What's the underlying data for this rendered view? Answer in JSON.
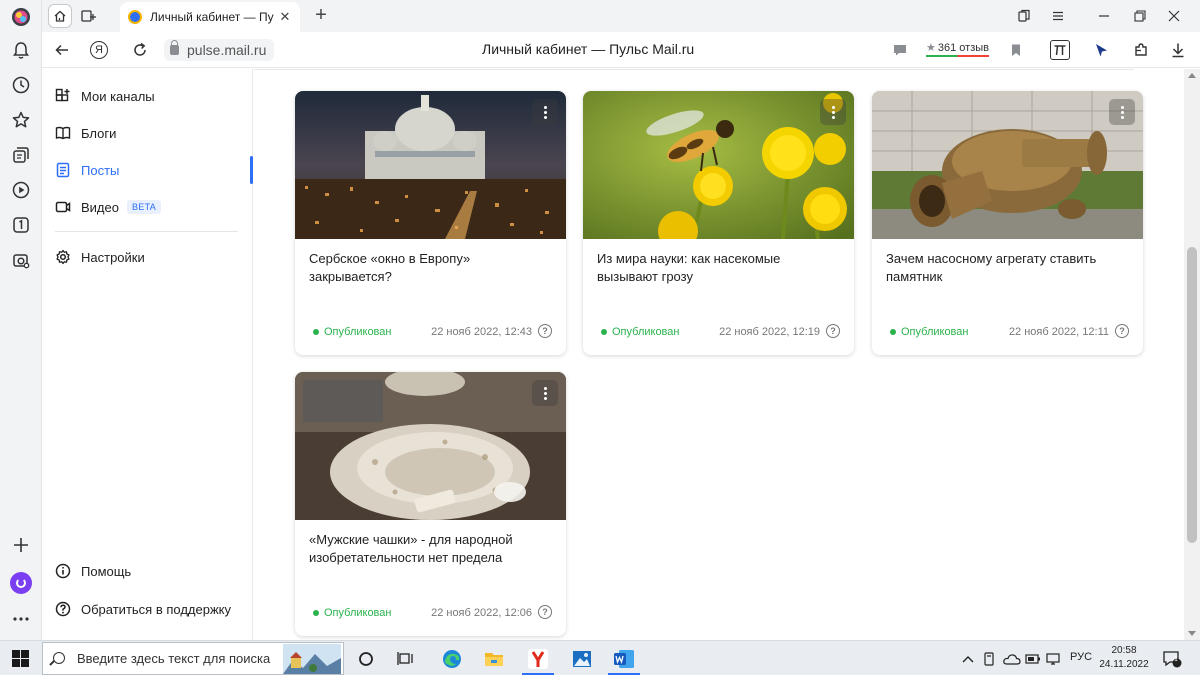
{
  "browser": {
    "tab_title": "Личный кабинет — Пу",
    "url": "pulse.mail.ru",
    "page_title": "Личный кабинет — Пульс Mail.ru",
    "rating_count": "361",
    "rating_label": "отзыв",
    "yandex_letter": "Я"
  },
  "sidebar": {
    "items": [
      {
        "label": "Мои каналы",
        "icon": "channels-icon"
      },
      {
        "label": "Блоги",
        "icon": "book-icon"
      },
      {
        "label": "Посты",
        "icon": "document-icon",
        "active": true
      },
      {
        "label": "Видео",
        "icon": "video-icon",
        "badge": "BETA"
      },
      {
        "label": "Настройки",
        "icon": "gear-icon"
      }
    ],
    "bottom": [
      {
        "label": "Помощь",
        "icon": "info-icon"
      },
      {
        "label": "Обратиться в поддержку",
        "icon": "question-icon"
      }
    ]
  },
  "posts": [
    {
      "title": "Сербское «окно в Европу» закрывается?",
      "status": "Опубликован",
      "date": "22 нояб 2022, 12:43",
      "image": "cathedral-photo"
    },
    {
      "title": "Из мира науки: как насекомые вызывают грозу",
      "status": "Опубликован",
      "date": "22 нояб 2022, 12:19",
      "image": "bee-photo"
    },
    {
      "title": "Зачем насосному агрегату ставить памятник",
      "status": "Опубликован",
      "date": "22 нояб 2022, 12:11",
      "image": "pump-photo"
    },
    {
      "title": "«Мужские чашки» - для народной изобретательности нет предела",
      "status": "Опубликован",
      "date": "22 нояб 2022, 12:06",
      "image": "cup-photo"
    }
  ],
  "help_glyph": "?",
  "taskbar": {
    "search_placeholder": "Введите здесь текст для поиска",
    "language": "РУС",
    "time": "20:58",
    "date": "24.11.2022",
    "notification_count": "1"
  },
  "colors": {
    "accent": "#2d6ff7",
    "published": "#2bb24c"
  }
}
